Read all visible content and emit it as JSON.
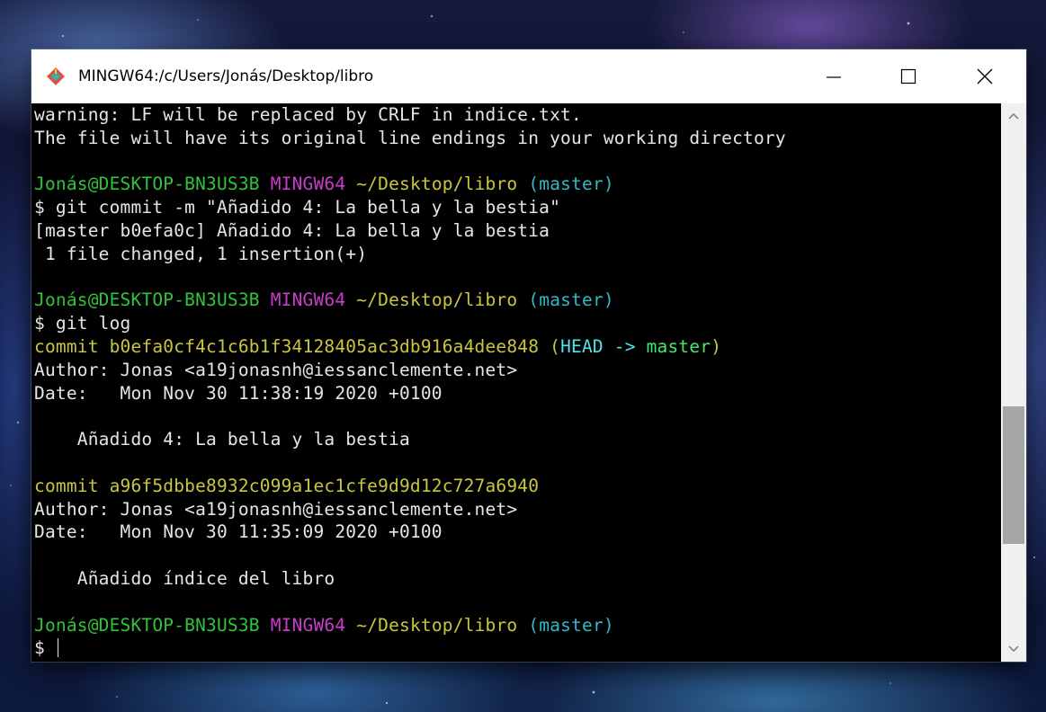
{
  "window": {
    "title": "MINGW64:/c/Users/Jonás/Desktop/libro"
  },
  "colors": {
    "default": "#e6e6e6",
    "user_host": "#31c33b",
    "mingw": "#c93ccb",
    "path": "#c9c73d",
    "branch": "#31b8c9",
    "head": "#4fe5ec",
    "master_ref": "#48e66a"
  },
  "icons": {
    "app": "git-for-windows-icon",
    "minimize": "minimize-icon",
    "maximize": "maximize-icon",
    "close": "close-icon",
    "scroll_up": "chevron-up-icon",
    "scroll_down": "chevron-down-icon"
  },
  "terminal": {
    "lines": [
      [
        {
          "t": "warning: LF will be replaced by CRLF in indice.txt.",
          "c": "default"
        }
      ],
      [
        {
          "t": "The file will have its original line endings in your working directory",
          "c": "default"
        }
      ],
      [],
      [
        {
          "t": "Jonás@DESKTOP-BN3US3B",
          "c": "green"
        },
        {
          "t": " ",
          "c": "default"
        },
        {
          "t": "MINGW64",
          "c": "magenta"
        },
        {
          "t": " ",
          "c": "default"
        },
        {
          "t": "~/Desktop/libro",
          "c": "yellow"
        },
        {
          "t": " ",
          "c": "default"
        },
        {
          "t": "(master)",
          "c": "cyan"
        }
      ],
      [
        {
          "t": "$ git commit -m \"Añadido 4: La bella y la bestia\"",
          "c": "default"
        }
      ],
      [
        {
          "t": "[master b0efa0c] Añadido 4: La bella y la bestia",
          "c": "default"
        }
      ],
      [
        {
          "t": " 1 file changed, 1 insertion(+)",
          "c": "default"
        }
      ],
      [],
      [
        {
          "t": "Jonás@DESKTOP-BN3US3B",
          "c": "green"
        },
        {
          "t": " ",
          "c": "default"
        },
        {
          "t": "MINGW64",
          "c": "magenta"
        },
        {
          "t": " ",
          "c": "default"
        },
        {
          "t": "~/Desktop/libro",
          "c": "yellow"
        },
        {
          "t": " ",
          "c": "default"
        },
        {
          "t": "(master)",
          "c": "cyan"
        }
      ],
      [
        {
          "t": "$ git log",
          "c": "default"
        }
      ],
      [
        {
          "t": "commit b0efa0cf4c1c6b1f34128405ac3db916a4dee848 (",
          "c": "yellow"
        },
        {
          "t": "HEAD -> ",
          "c": "bcyan"
        },
        {
          "t": "master",
          "c": "bgreen"
        },
        {
          "t": ")",
          "c": "yellow"
        }
      ],
      [
        {
          "t": "Author: Jonas <a19jonasnh@iessanclemente.net>",
          "c": "default"
        }
      ],
      [
        {
          "t": "Date:   Mon Nov 30 11:38:19 2020 +0100",
          "c": "default"
        }
      ],
      [],
      [
        {
          "t": "    Añadido 4: La bella y la bestia",
          "c": "default"
        }
      ],
      [],
      [
        {
          "t": "commit a96f5dbbe8932c099a1ec1cfe9d9d12c727a6940",
          "c": "yellow"
        }
      ],
      [
        {
          "t": "Author: Jonas <a19jonasnh@iessanclemente.net>",
          "c": "default"
        }
      ],
      [
        {
          "t": "Date:   Mon Nov 30 11:35:09 2020 +0100",
          "c": "default"
        }
      ],
      [],
      [
        {
          "t": "    Añadido índice del libro",
          "c": "default"
        }
      ],
      [],
      [
        {
          "t": "Jonás@DESKTOP-BN3US3B",
          "c": "green"
        },
        {
          "t": " ",
          "c": "default"
        },
        {
          "t": "MINGW64",
          "c": "magenta"
        },
        {
          "t": " ",
          "c": "default"
        },
        {
          "t": "~/Desktop/libro",
          "c": "yellow"
        },
        {
          "t": " ",
          "c": "default"
        },
        {
          "t": "(master)",
          "c": "cyan"
        }
      ],
      [
        {
          "t": "$ ",
          "c": "default"
        }
      ]
    ]
  },
  "scrollbar": {
    "scroll_position": 0.75,
    "visible_fraction": 0.27
  }
}
